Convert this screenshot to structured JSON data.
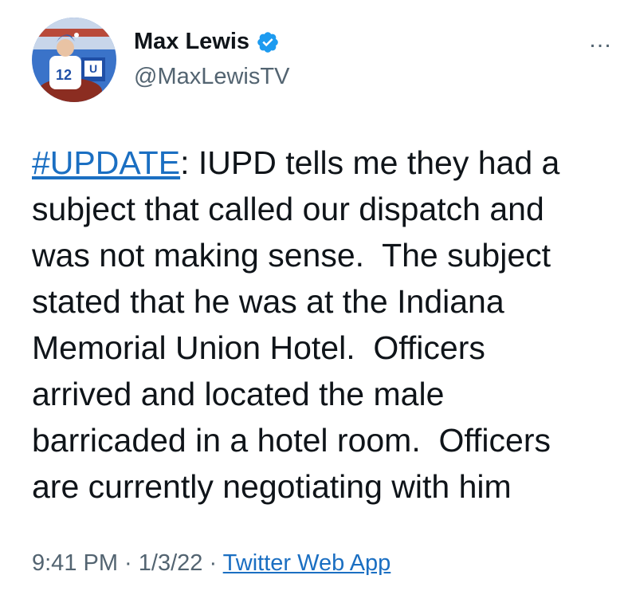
{
  "author": {
    "display_name": "Max Lewis",
    "handle": "@MaxLewisTV",
    "verified": true,
    "avatar_icon": "profile-photo",
    "avatar_jersey_number": "12",
    "avatar_logo": "U"
  },
  "more_icon": "…",
  "tweet": {
    "hashtag": "#UPDATE",
    "line1_rest": ": IUPD tells me they had a",
    "lines": [
      "subject that called our dispatch and",
      "was not making sense.  The subject",
      "stated that he was at the Indiana",
      "Memorial Union Hotel.  Officers",
      "arrived and located the male",
      "barricaded in a hotel room.  Officers",
      "are currently negotiating with him"
    ]
  },
  "meta": {
    "time": "9:41 PM",
    "separator": " · ",
    "date": "1/3/22",
    "source": "Twitter Web App"
  },
  "colors": {
    "link": "#1b6fc2",
    "verified_badge": "#1d9bf0",
    "secondary_text": "#536471"
  }
}
